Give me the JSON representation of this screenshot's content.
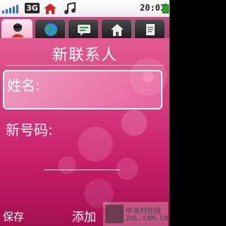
{
  "status_bar": {
    "network": "3G",
    "time": "20:01",
    "icons": [
      "signal-icon",
      "home-zone-icon",
      "music-icon",
      "battery-icon"
    ]
  },
  "tabs": [
    {
      "icon": "contact-person-icon",
      "active": true
    },
    {
      "icon": "globe-icon",
      "active": false
    },
    {
      "icon": "message-icon",
      "active": false
    },
    {
      "icon": "home-icon",
      "active": false
    },
    {
      "icon": "note-icon",
      "active": false
    }
  ],
  "form": {
    "title": "新联系人",
    "name_label": "姓名:",
    "phone_label": "新号码:"
  },
  "softkeys": {
    "left": "保存",
    "center": "添加"
  },
  "watermark": {
    "line1": "中关村在线",
    "line2": "ZOL.COM.CN"
  },
  "colors": {
    "accent": "#d53a7d",
    "background_dark": "#a3104f",
    "text": "#ffffff"
  }
}
